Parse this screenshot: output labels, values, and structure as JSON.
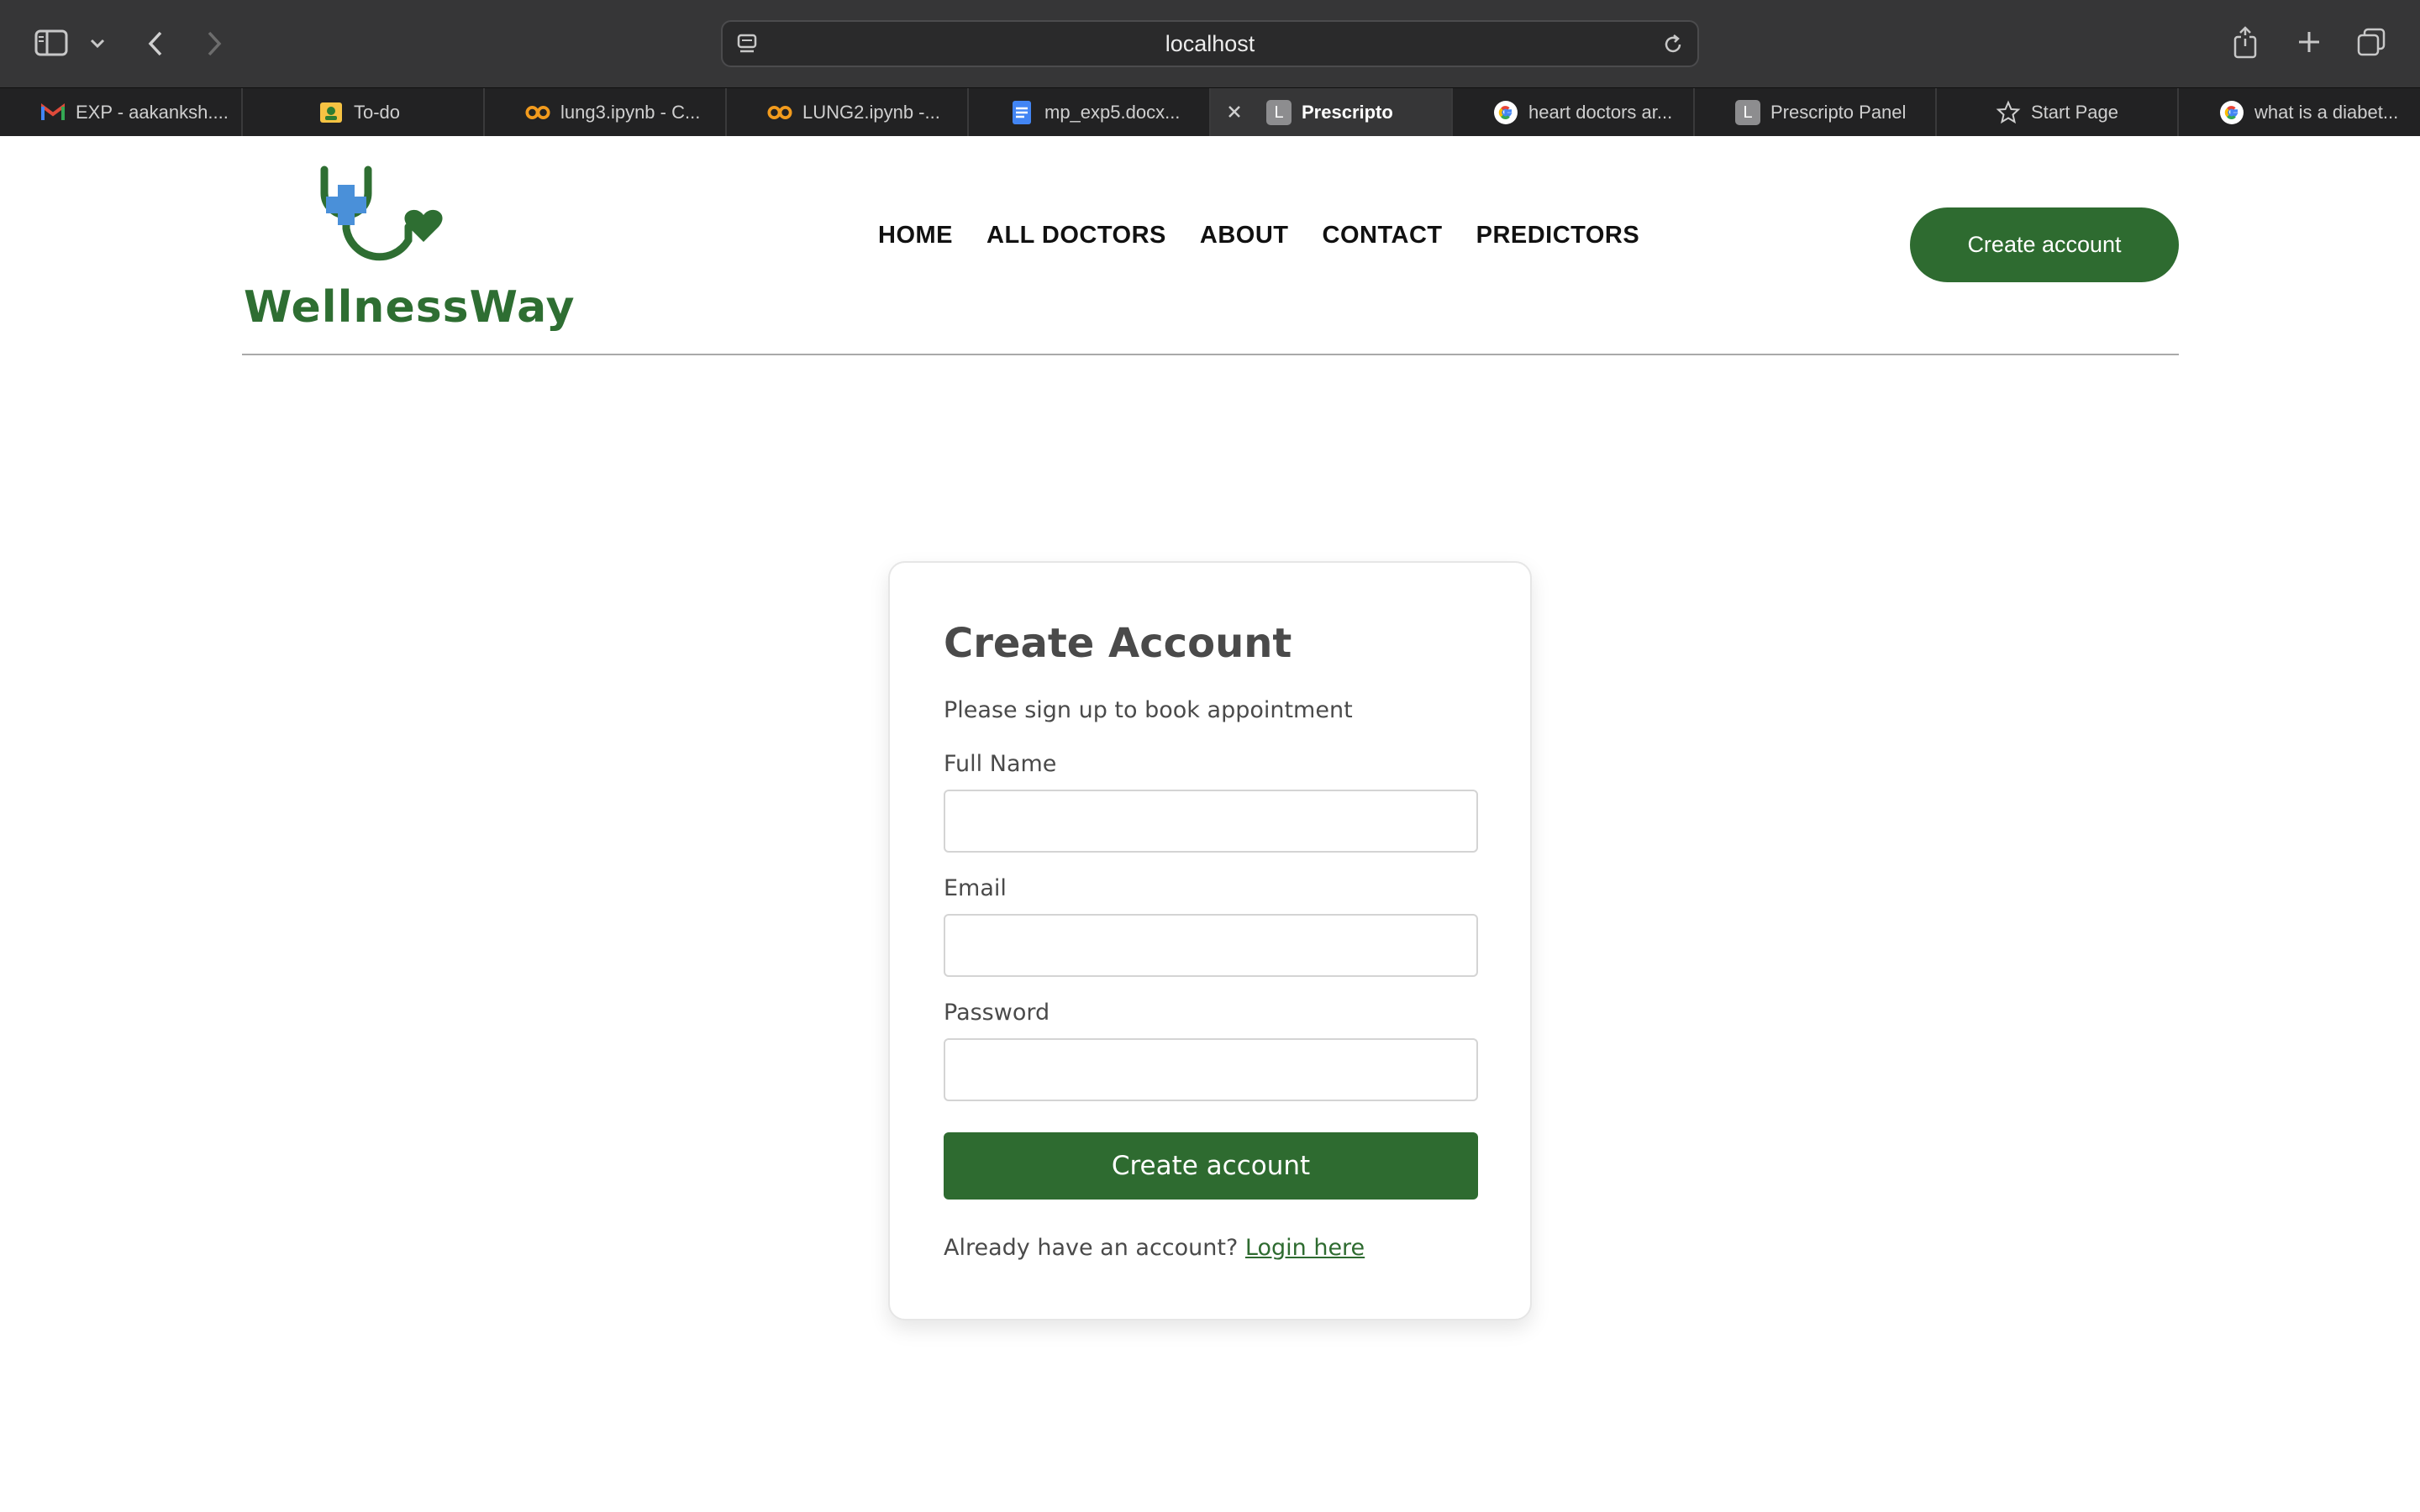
{
  "browser": {
    "url": "localhost",
    "tabs": [
      {
        "label": "EXP - aakanksh....",
        "icon": "gmail-icon"
      },
      {
        "label": "To-do",
        "icon": "todo-icon"
      },
      {
        "label": "lung3.ipynb - C...",
        "icon": "colab-icon"
      },
      {
        "label": "LUNG2.ipynb -...",
        "icon": "colab-icon"
      },
      {
        "label": "mp_exp5.docx...",
        "icon": "docs-icon"
      },
      {
        "label": "Prescripto",
        "icon": "letter-l-icon",
        "favicon_letter": "L",
        "active": true
      },
      {
        "label": "heart doctors ar...",
        "icon": "google-icon"
      },
      {
        "label": "Prescripto Panel",
        "icon": "letter-l-icon",
        "favicon_letter": "L"
      },
      {
        "label": "Start Page",
        "icon": "star-icon"
      },
      {
        "label": "what is a diabet...",
        "icon": "google-icon"
      }
    ]
  },
  "header": {
    "logo_text": "WellnessWay",
    "nav": [
      "HOME",
      "ALL DOCTORS",
      "ABOUT",
      "CONTACT",
      "PREDICTORS"
    ],
    "cta_label": "Create account"
  },
  "form": {
    "title": "Create Account",
    "subtitle": "Please sign up to book appointment",
    "fields": [
      {
        "label": "Full Name",
        "value": ""
      },
      {
        "label": "Email",
        "value": ""
      },
      {
        "label": "Password",
        "value": ""
      }
    ],
    "submit_label": "Create account",
    "login_prompt": "Already have an account?",
    "login_link": "Login here"
  },
  "colors": {
    "brand_green": "#2e6b30",
    "logo_blue": "#4a90d9"
  }
}
